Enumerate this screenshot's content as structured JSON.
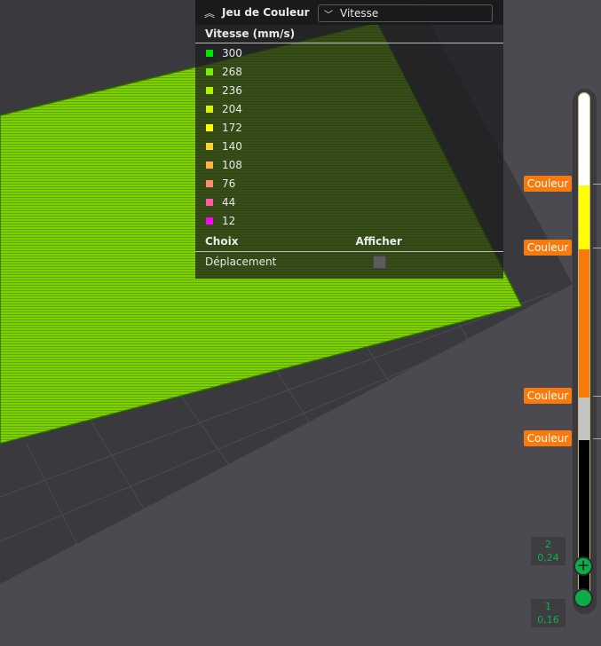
{
  "legend": {
    "title": "Jeu de Couleur",
    "collapse_icon": "double-chevron-up-icon",
    "dropdown_value": "Vitesse",
    "section_title": "Vitesse (mm/s)",
    "items": [
      {
        "label": "300",
        "color": "#00e500"
      },
      {
        "label": "268",
        "color": "#73f200"
      },
      {
        "label": "236",
        "color": "#b0f500"
      },
      {
        "label": "204",
        "color": "#d5f500"
      },
      {
        "label": "172",
        "color": "#ffff00"
      },
      {
        "label": "140",
        "color": "#ffd12e"
      },
      {
        "label": "108",
        "color": "#ffb04a"
      },
      {
        "label": "76",
        "color": "#ff8a70"
      },
      {
        "label": "44",
        "color": "#ff5aa8"
      },
      {
        "label": "12",
        "color": "#ff00ff"
      }
    ],
    "options_header": {
      "choice": "Choix",
      "show": "Afficher"
    },
    "options": [
      {
        "label": "Déplacement",
        "checked": false
      }
    ]
  },
  "layer_slider": {
    "color_tags": [
      "Couleur",
      "Couleur",
      "Couleur",
      "Couleur"
    ],
    "upper": {
      "layer": "2",
      "height": "0,24"
    },
    "lower": {
      "layer": "1",
      "height": "0,16"
    }
  }
}
